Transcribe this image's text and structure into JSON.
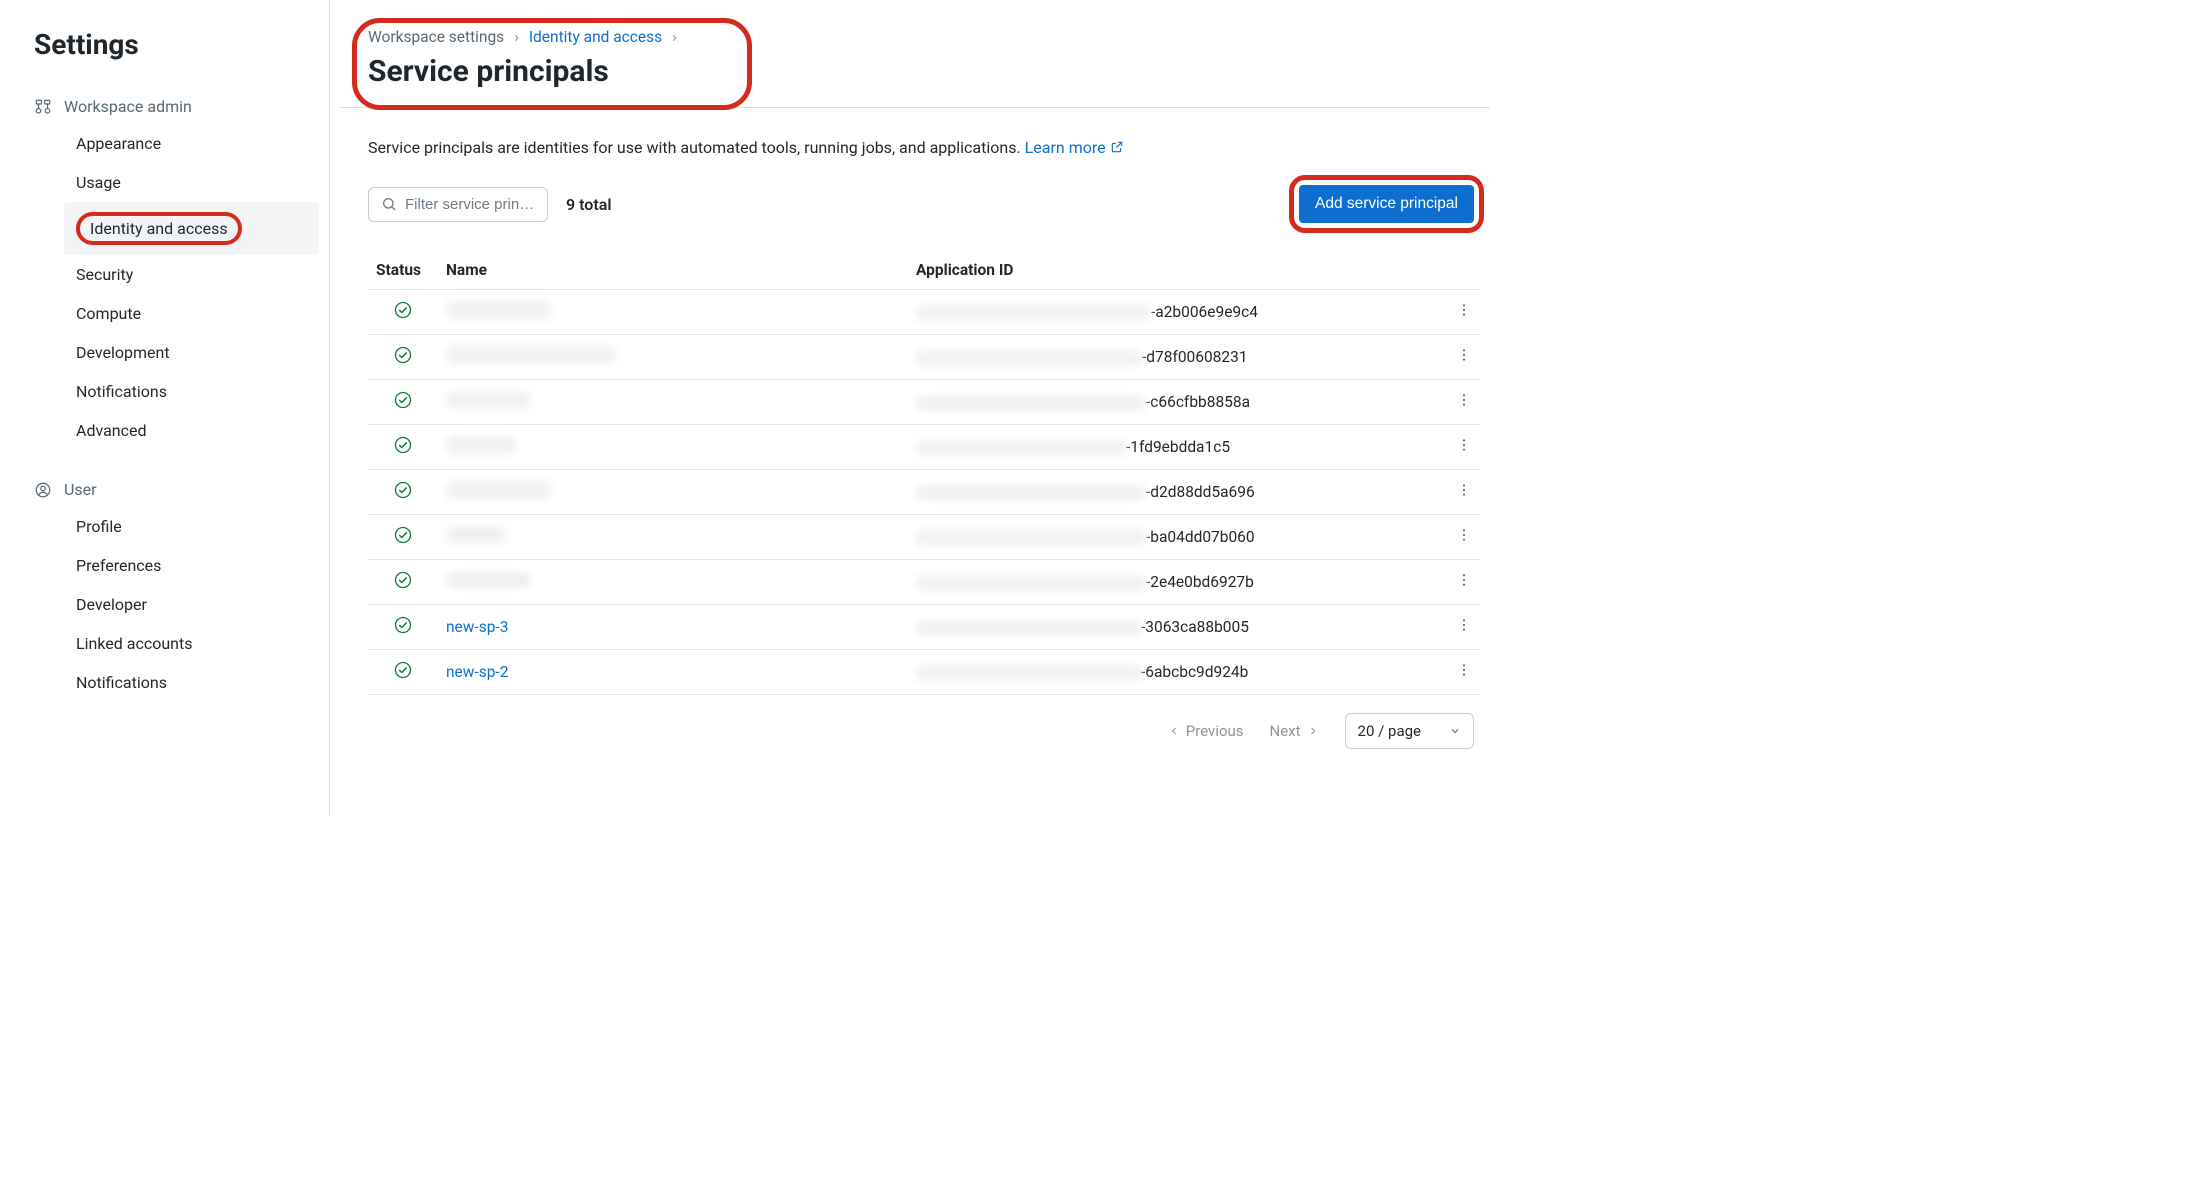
{
  "sidebar": {
    "title": "Settings",
    "sections": [
      {
        "header": "Workspace admin",
        "items": [
          {
            "label": "Appearance"
          },
          {
            "label": "Usage"
          },
          {
            "label": "Identity and access",
            "active": true,
            "highlighted": true
          },
          {
            "label": "Security"
          },
          {
            "label": "Compute"
          },
          {
            "label": "Development"
          },
          {
            "label": "Notifications"
          },
          {
            "label": "Advanced"
          }
        ]
      },
      {
        "header": "User",
        "items": [
          {
            "label": "Profile"
          },
          {
            "label": "Preferences"
          },
          {
            "label": "Developer"
          },
          {
            "label": "Linked accounts"
          },
          {
            "label": "Notifications"
          }
        ]
      }
    ]
  },
  "breadcrumbs": {
    "root": "Workspace settings",
    "parent": "Identity and access"
  },
  "page_title": "Service principals",
  "description": {
    "text": "Service principals are identities for use with automated tools, running jobs, and applications. ",
    "learn_more": "Learn more"
  },
  "toolbar": {
    "filter_placeholder": "Filter service prin…",
    "total_label": "9 total",
    "add_button": "Add service principal"
  },
  "table": {
    "columns": {
      "status": "Status",
      "name": "Name",
      "appid": "Application ID"
    },
    "rows": [
      {
        "name": "",
        "name_redacted": true,
        "name_blur_w": 105,
        "appid_blur_w": 235,
        "appid_suffix": "-a2b006e9e9c4"
      },
      {
        "name": "",
        "name_redacted": true,
        "name_blur_w": 170,
        "appid_blur_w": 226,
        "appid_suffix": "-d78f00608231"
      },
      {
        "name": "",
        "name_redacted": true,
        "name_blur_w": 85,
        "appid_blur_w": 230,
        "appid_suffix": "-c66cfbb8858a"
      },
      {
        "name": "",
        "name_redacted": true,
        "name_blur_w": 70,
        "appid_blur_w": 210,
        "appid_suffix": "-1fd9ebdda1c5"
      },
      {
        "name": "",
        "name_redacted": true,
        "name_blur_w": 105,
        "appid_blur_w": 230,
        "appid_suffix": "-d2d88dd5a696"
      },
      {
        "name": "",
        "name_redacted": true,
        "name_blur_w": 60,
        "appid_blur_w": 230,
        "appid_suffix": "-ba04dd07b060"
      },
      {
        "name": "",
        "name_redacted": true,
        "name_blur_w": 85,
        "appid_blur_w": 230,
        "appid_suffix": "-2e4e0bd6927b"
      },
      {
        "name": "new-sp-3",
        "name_redacted": false,
        "appid_blur_w": 225,
        "appid_suffix": "-3063ca88b005"
      },
      {
        "name": "new-sp-2",
        "name_redacted": false,
        "appid_blur_w": 225,
        "appid_suffix": "-6abcbc9d924b"
      }
    ]
  },
  "pagination": {
    "prev": "Previous",
    "next": "Next",
    "page_size": "20 / page"
  }
}
